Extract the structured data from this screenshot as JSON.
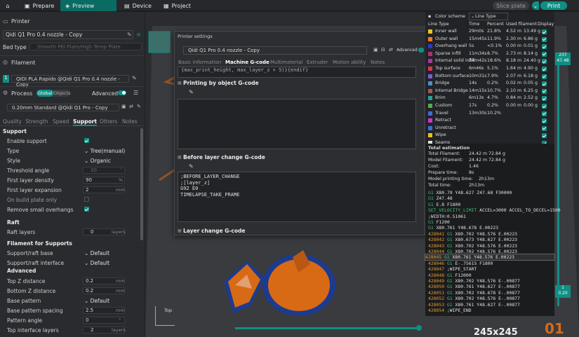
{
  "topbar": {
    "prepare": "Prepare",
    "preview": "Preview",
    "device": "Device",
    "project": "Project",
    "slice_plate": "Slice plate",
    "print": "Print"
  },
  "printer": {
    "section": "Printer",
    "preset": "Qidi Q1 Pro 0.4 nozzle - Copy",
    "bed_type_label": "Bed type",
    "bed_type_value": "Smooth PEI Plate/High Temp Plate"
  },
  "filament": {
    "section": "Filament",
    "index": "1",
    "preset": "QIDI PLA Rapido @Qidi Q1 Pro 0.4 nozzle - Copy"
  },
  "process": {
    "section": "Process",
    "global": "Global",
    "objects": "Objects",
    "advanced": "Advanced",
    "preset": "0.20mm Standard @Qidi Q1 Pro - Copy",
    "tabs": [
      "Quality",
      "Strength",
      "Speed",
      "Support",
      "Others",
      "Notes"
    ],
    "active_tab": "Support"
  },
  "support": {
    "header": "Support",
    "enable_support": "Enable support",
    "type_label": "Type",
    "type_value": "Tree(manual)",
    "style_label": "Style",
    "style_value": "Organic",
    "threshold_label": "Threshold angle",
    "threshold_value": "30",
    "threshold_unit": "°",
    "first_density_label": "First layer density",
    "first_density_value": "90",
    "first_density_unit": "%",
    "first_expansion_label": "First layer expansion",
    "first_expansion_value": "2",
    "first_expansion_unit": "mm",
    "build_plate_label": "On build plate only",
    "remove_overhangs_label": "Remove small overhangs",
    "raft_header": "Raft",
    "raft_layers_label": "Raft layers",
    "raft_layers_value": "0",
    "raft_layers_unit": "layers",
    "filament_header": "Filament for Supports",
    "raft_base_label": "Support/raft base",
    "raft_base_value": "Default",
    "raft_interface_label": "Support/raft interface",
    "raft_interface_value": "Default",
    "advanced_header": "Advanced",
    "top_z_label": "Top Z distance",
    "top_z_value": "0.2",
    "top_z_unit": "mm",
    "bottom_z_label": "Bottom Z distance",
    "bottom_z_value": "0.2",
    "bottom_z_unit": "mm",
    "base_pattern_label": "Base pattern",
    "base_pattern_value": "Default",
    "base_spacing_label": "Base pattern spacing",
    "base_spacing_value": "2.5",
    "base_spacing_unit": "mm",
    "pattern_angle_label": "Pattern angle",
    "pattern_angle_value": "0",
    "pattern_angle_unit": "°",
    "top_interface_label": "Top interface layers",
    "top_interface_value": "2",
    "top_interface_unit": "layers"
  },
  "dialog": {
    "title": "Printer settings",
    "preset": "Qidi Q1 Pro 0.4 nozzle - Copy",
    "advanced": "Advanced",
    "tabs": [
      "Basic information",
      "Machine G-code",
      "Multimaterial",
      "Extruder",
      "Motion ability",
      "Notes"
    ],
    "active_tab": "Machine G-code",
    "top_code": "{max_print_height, max_layer_z + 5)}{endif}",
    "by_object_label": "Printing by object G-code",
    "before_layer_label": "Before layer change G-code",
    "before_layer_code": [
      ";BEFORE_LAYER_CHANGE",
      ";[layer_z]",
      "G92 E0",
      "TIMELAPSE_TAKE_FRAME"
    ],
    "layer_change_label": "Layer change G-code"
  },
  "legend": {
    "scheme_label": "Color scheme",
    "scheme_value": "Line Type",
    "columns": [
      "Line Type",
      "Time",
      "Percent",
      "Used filament",
      "Display"
    ],
    "rows": [
      {
        "name": "Inner wall",
        "time": "29m0s",
        "pct": "21.8%",
        "len": "4.52 m",
        "g": "13.49 g",
        "color": "#f0c419"
      },
      {
        "name": "Outer wall",
        "time": "15m45s",
        "pct": "11.9%",
        "len": "2.30 m",
        "g": "6.86 g",
        "color": "#f07d19"
      },
      {
        "name": "Overhang wall",
        "time": "5s",
        "pct": "<0.1%",
        "len": "0.00 m",
        "g": "0.01 g",
        "color": "#2a35d6"
      },
      {
        "name": "Sparse infill",
        "time": "11m34s",
        "pct": "8.7%",
        "len": "2.73 m",
        "g": "8.14 g",
        "color": "#b0306e"
      },
      {
        "name": "Internal solid infill",
        "time": "24m42s",
        "pct": "18.6%",
        "len": "8.18 m",
        "g": "24.40 g",
        "color": "#a23a9d"
      },
      {
        "name": "Top surface",
        "time": "6m46s",
        "pct": "5.1%",
        "len": "1.64 m",
        "g": "4.90 g",
        "color": "#e0324d"
      },
      {
        "name": "Bottom surface",
        "time": "10m31s",
        "pct": "7.9%",
        "len": "2.07 m",
        "g": "6.18 g",
        "color": "#7a5fd4"
      },
      {
        "name": "Bridge",
        "time": "14s",
        "pct": "0.2%",
        "len": "0.02 m",
        "g": "0.05 g",
        "color": "#4f8ec9"
      },
      {
        "name": "Internal Bridge",
        "time": "14m15s",
        "pct": "10.7%",
        "len": "2.10 m",
        "g": "6.25 g",
        "color": "#a35a5a"
      },
      {
        "name": "Brim",
        "time": "6m13s",
        "pct": "4.7%",
        "len": "0.84 m",
        "g": "2.52 g",
        "color": "#1fa39a"
      },
      {
        "name": "Custom",
        "time": "17s",
        "pct": "0.2%",
        "len": "0.00 m",
        "g": "0.00 g",
        "color": "#4faf4a"
      },
      {
        "name": "Travel",
        "time": "13m30s",
        "pct": "10.2%",
        "len": "",
        "g": "",
        "color": "#3b6fd4"
      },
      {
        "name": "Retract",
        "time": "",
        "pct": "",
        "len": "",
        "g": "",
        "color": "#d432c8"
      },
      {
        "name": "Unretract",
        "time": "",
        "pct": "",
        "len": "",
        "g": "",
        "color": "#3b6fd4"
      },
      {
        "name": "Wipe",
        "time": "",
        "pct": "",
        "len": "",
        "g": "",
        "color": "#e6c21f"
      },
      {
        "name": "Seams",
        "time": "",
        "pct": "",
        "len": "",
        "g": "",
        "color": "#e0e0e0"
      }
    ]
  },
  "estimation": {
    "header": "Total estimation",
    "total_filament_label": "Total Filament:",
    "total_filament_len": "24.42 m",
    "total_filament_g": "72.84 g",
    "model_filament_label": "Model Filament:",
    "model_filament_len": "24.42 m",
    "model_filament_g": "72.84 g",
    "cost_label": "Cost:",
    "cost_value": "1.46",
    "prepare_label": "Prepare time:",
    "prepare_value": "8s",
    "model_time_label": "Model printing time:",
    "model_time_value": "2h13m",
    "total_time_label": "Total time:",
    "total_time_value": "2h13m"
  },
  "gcode": [
    {
      "n": "",
      "g": "G1",
      "t": "X80.79 Y48.627 Z47.68 F30000"
    },
    {
      "n": "",
      "g": "G1",
      "t": "Z47.48"
    },
    {
      "n": "",
      "g": "G1",
      "t": "E.8 F1800"
    },
    {
      "n": "",
      "g": "SET_VELOCITY_LIMIT",
      "t": "ACCEL=3000 ACCEL_TO_DECEL=1500"
    },
    {
      "n": "",
      "g": "",
      "t": ";WIDTH:0.51061"
    },
    {
      "n": "",
      "g": "G1",
      "t": "F1200"
    },
    {
      "n": "",
      "g": "G1",
      "t": "X80.761 Y48.678 E.00223"
    },
    {
      "n": "428041",
      "g": "G1",
      "t": "X80.702 Y48.576 E.00223"
    },
    {
      "n": "428042",
      "g": "G1",
      "t": "X80.673 Y48.627 E.00223"
    },
    {
      "n": "428043",
      "g": "G1",
      "t": "X80.702 Y48.576 E.00223"
    },
    {
      "n": "428044",
      "g": "G1",
      "t": "X80.702 Y48.576 E.00223"
    },
    {
      "n": "428045",
      "g": "G1",
      "t": "X80.761 Y48.576 E.00223"
    },
    {
      "n": "428046",
      "g": "G1",
      "t": "E-.75615 F1800"
    },
    {
      "n": "428047",
      "g": "",
      "t": ";WIPE_START"
    },
    {
      "n": "428048",
      "g": "G1",
      "t": "F12000"
    },
    {
      "n": "428049",
      "g": "G1",
      "t": "X80.702 Y48.576 E-.00877"
    },
    {
      "n": "428050",
      "g": "G1",
      "t": "X80.761 Y48.627 E-.00877"
    },
    {
      "n": "428051",
      "g": "G1",
      "t": "X80.702 Y48.678 E-.00877"
    },
    {
      "n": "428052",
      "g": "G1",
      "t": "X80.702 Y48.576 E-.00877"
    },
    {
      "n": "428053",
      "g": "G1",
      "t": "X80.761 Y48.627 E-.00877"
    },
    {
      "n": "428054",
      "g": "",
      "t": ";WIPE_END"
    }
  ],
  "viewport": {
    "bed_size": "245x245",
    "plate_number": "01",
    "layer_top": "237",
    "layer_top_height": "47.48",
    "layer_bottom": "1",
    "layer_bottom_height": "0.20",
    "view_label": "Top"
  },
  "colors": {
    "accent": "#0f8f84",
    "model_orange": "#d86a16",
    "bed_blue": "#1c3b8f"
  }
}
